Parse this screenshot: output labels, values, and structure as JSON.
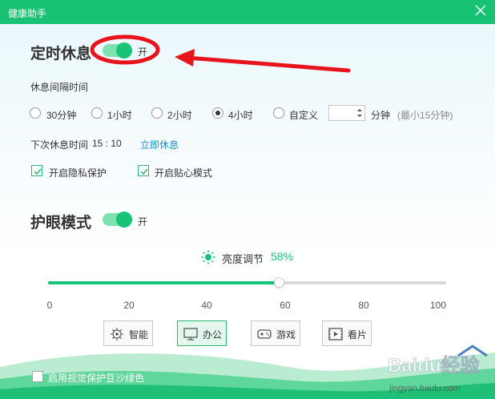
{
  "window": {
    "title": "健康助手"
  },
  "rest": {
    "title": "定时休息",
    "toggle_label": "开",
    "interval_heading": "休息间隔时间",
    "options": [
      "30分钟",
      "1小时",
      "2小时",
      "4小时",
      "自定义"
    ],
    "selected_option": "4小时",
    "custom_value": "",
    "custom_unit": "分钟",
    "custom_hint": "(最小15分钟)",
    "next_rest_label": "下次休息时间",
    "next_rest_time": "15 : 10",
    "rest_now_link": "立即休息",
    "privacy_checkbox": "开启隐私保护",
    "caring_checkbox": "开启贴心模式"
  },
  "eye": {
    "title": "护眼模式",
    "toggle_label": "开",
    "brightness_label": "亮度调节",
    "brightness_value": "58%",
    "brightness_fraction": 0.58,
    "ticks": [
      "0",
      "20",
      "40",
      "60",
      "80",
      "100"
    ],
    "modes": [
      "智能",
      "办公",
      "游戏",
      "看片"
    ],
    "active_mode": "办公",
    "green_bg_checkbox": "启用视觉保护豆沙绿色"
  },
  "colors": {
    "accent": "#16c377",
    "titlebar": "#17c273",
    "link": "#1a8fd1",
    "annotation": "#e8141c"
  },
  "watermark": {
    "brand": "Baidu经验",
    "url": "jingyan.baidu.com"
  }
}
